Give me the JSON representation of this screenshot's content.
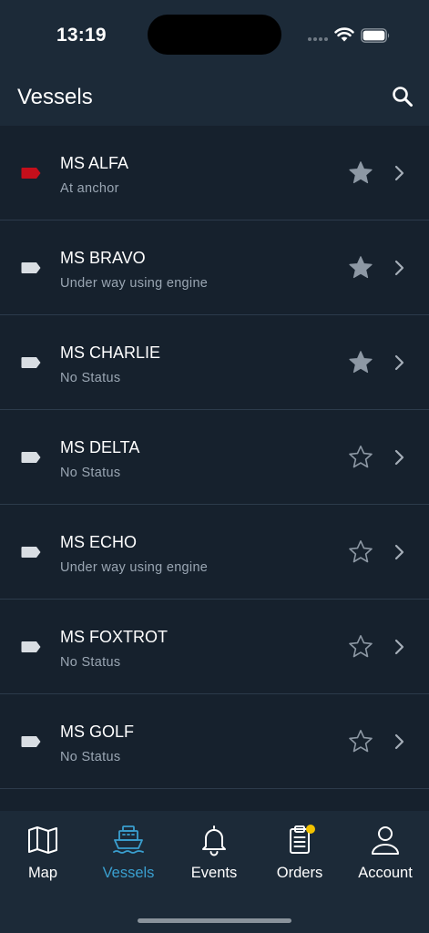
{
  "status_bar": {
    "time": "13:19"
  },
  "header": {
    "title": "Vessels"
  },
  "vessels": [
    {
      "name": "MS ALFA",
      "status": "At anchor",
      "favorite": true,
      "color": "#c40f1b"
    },
    {
      "name": "MS BRAVO",
      "status": "Under way using engine",
      "favorite": true,
      "color": "#d9dee3"
    },
    {
      "name": "MS CHARLIE",
      "status": "No Status",
      "favorite": true,
      "color": "#d9dee3"
    },
    {
      "name": "MS DELTA",
      "status": "No Status",
      "favorite": false,
      "color": "#d9dee3"
    },
    {
      "name": "MS ECHO",
      "status": "Under way using engine",
      "favorite": false,
      "color": "#d9dee3"
    },
    {
      "name": "MS FOXTROT",
      "status": "No Status",
      "favorite": false,
      "color": "#d9dee3"
    },
    {
      "name": "MS GOLF",
      "status": "No Status",
      "favorite": false,
      "color": "#d9dee3"
    }
  ],
  "tabs": [
    {
      "label": "Map",
      "icon": "map-icon",
      "active": false
    },
    {
      "label": "Vessels",
      "icon": "ship-icon",
      "active": true
    },
    {
      "label": "Events",
      "icon": "bell-icon",
      "active": false
    },
    {
      "label": "Orders",
      "icon": "clipboard-icon",
      "active": false,
      "badge": true
    },
    {
      "label": "Account",
      "icon": "person-icon",
      "active": false
    }
  ],
  "colors": {
    "background": "#16212d",
    "bar": "#1c2a38",
    "accent": "#3a9fcf",
    "star": "#8d98a4",
    "badge": "#f2c200"
  }
}
